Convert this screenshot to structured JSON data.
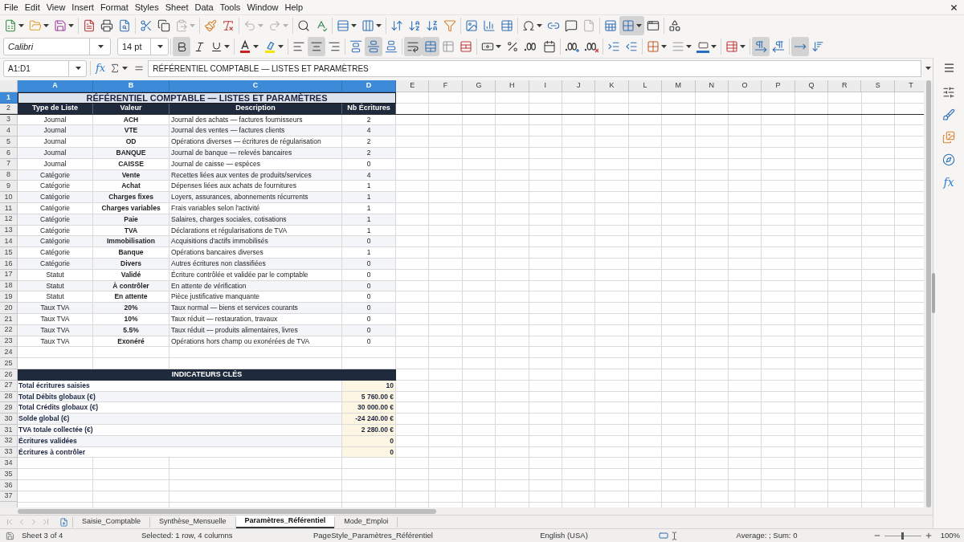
{
  "menu_bar": {
    "items": [
      "File",
      "Edit",
      "View",
      "Insert",
      "Format",
      "Styles",
      "Sheet",
      "Data",
      "Tools",
      "Window",
      "Help"
    ]
  },
  "standard_toolbar": {
    "paste_enabled": false,
    "undo_enabled": false,
    "redo_enabled": false,
    "headers_footers_enabled": false,
    "freeze_panes_active": true
  },
  "formatting_toolbar": {
    "font_name": "Calibri",
    "font_size": "14 pt",
    "bold": true,
    "italic": false,
    "underline": false,
    "align_left": false,
    "align_center": true,
    "align_right": false,
    "align_top": false,
    "align_middle": true,
    "align_bottom": false,
    "wrap_text": true,
    "merge_and_center": true,
    "left_to_right": true,
    "right_to_left": false,
    "text_horizontal": true,
    "text_vertical": false
  },
  "formula_bar": {
    "name_box": "A1:D1",
    "function_wizard": "fx",
    "content": "RÉFÉRENTIEL COMPTABLE — LISTES ET PARAMÈTRES"
  },
  "sidebar": {
    "functions_label": "fx"
  },
  "sheet": {
    "column_headers": [
      {
        "label": "A",
        "selected": true
      },
      {
        "label": "B",
        "selected": true
      },
      {
        "label": "C",
        "selected": true
      },
      {
        "label": "D",
        "selected": true
      },
      {
        "label": "E",
        "selected": false
      },
      {
        "label": "F",
        "selected": false
      },
      {
        "label": "G",
        "selected": false
      },
      {
        "label": "H",
        "selected": false
      },
      {
        "label": "I",
        "selected": false
      },
      {
        "label": "J",
        "selected": false
      },
      {
        "label": "K",
        "selected": false
      },
      {
        "label": "L",
        "selected": false
      },
      {
        "label": "M",
        "selected": false
      },
      {
        "label": "N",
        "selected": false
      },
      {
        "label": "O",
        "selected": false
      },
      {
        "label": "P",
        "selected": false
      },
      {
        "label": "Q",
        "selected": false
      },
      {
        "label": "R",
        "selected": false
      },
      {
        "label": "S",
        "selected": false
      },
      {
        "label": "T",
        "selected": false
      }
    ],
    "row_headers": [
      {
        "label": "1",
        "selected": true
      },
      {
        "label": "2",
        "selected": false
      },
      {
        "label": "3",
        "selected": false
      },
      {
        "label": "4",
        "selected": false
      },
      {
        "label": "5",
        "selected": false
      },
      {
        "label": "6",
        "selected": false
      },
      {
        "label": "7",
        "selected": false
      },
      {
        "label": "8",
        "selected": false
      },
      {
        "label": "9",
        "selected": false
      },
      {
        "label": "10",
        "selected": false
      },
      {
        "label": "11",
        "selected": false
      },
      {
        "label": "12",
        "selected": false
      },
      {
        "label": "13",
        "selected": false
      },
      {
        "label": "14",
        "selected": false
      },
      {
        "label": "15",
        "selected": false
      },
      {
        "label": "16",
        "selected": false
      },
      {
        "label": "17",
        "selected": false
      },
      {
        "label": "18",
        "selected": false
      },
      {
        "label": "19",
        "selected": false
      },
      {
        "label": "20",
        "selected": false
      },
      {
        "label": "21",
        "selected": false
      },
      {
        "label": "22",
        "selected": false
      },
      {
        "label": "23",
        "selected": false
      },
      {
        "label": "24",
        "selected": false
      },
      {
        "label": "25",
        "selected": false
      },
      {
        "label": "26",
        "selected": false
      },
      {
        "label": "27",
        "selected": false
      },
      {
        "label": "28",
        "selected": false
      },
      {
        "label": "29",
        "selected": false
      },
      {
        "label": "30",
        "selected": false
      },
      {
        "label": "31",
        "selected": false
      },
      {
        "label": "32",
        "selected": false
      },
      {
        "label": "33",
        "selected": false
      },
      {
        "label": "34",
        "selected": false
      },
      {
        "label": "35",
        "selected": false
      },
      {
        "label": "36",
        "selected": false
      },
      {
        "label": "37",
        "selected": false
      }
    ],
    "title": "RÉFÉRENTIEL COMPTABLE — LISTES ET PARAMÈTRES",
    "header": [
      "Type de Liste",
      "Valeur",
      "Description",
      "Nb Écritures"
    ],
    "rows": [
      [
        "Journal",
        "ACH",
        "Journal des achats — factures fournisseurs",
        "2"
      ],
      [
        "Journal",
        "VTE",
        "Journal des ventes — factures clients",
        "4"
      ],
      [
        "Journal",
        "OD",
        "Opérations diverses — écritures de régularisation",
        "2"
      ],
      [
        "Journal",
        "BANQUE",
        "Journal de banque — relevés bancaires",
        "2"
      ],
      [
        "Journal",
        "CAISSE",
        "Journal de caisse — espèces",
        "0"
      ],
      [
        "Catégorie",
        "Vente",
        "Recettes liées aux ventes de produits/services",
        "4"
      ],
      [
        "Catégorie",
        "Achat",
        "Dépenses liées aux achats de fournitures",
        "1"
      ],
      [
        "Catégorie",
        "Charges fixes",
        "Loyers, assurances, abonnements récurrents",
        "1"
      ],
      [
        "Catégorie",
        "Charges variables",
        "Frais variables selon l'activité",
        "1"
      ],
      [
        "Catégorie",
        "Paie",
        "Salaires, charges sociales, cotisations",
        "1"
      ],
      [
        "Catégorie",
        "TVA",
        "Déclarations et régularisations de TVA",
        "1"
      ],
      [
        "Catégorie",
        "Immobilisation",
        "Acquisitions d'actifs immobilisés",
        "0"
      ],
      [
        "Catégorie",
        "Banque",
        "Opérations bancaires diverses",
        "1"
      ],
      [
        "Catégorie",
        "Divers",
        "Autres écritures non classifiées",
        "0"
      ],
      [
        "Statut",
        "Validé",
        "Écriture contrôlée et validée par le comptable",
        "0"
      ],
      [
        "Statut",
        "À contrôler",
        "En attente de vérification",
        "0"
      ],
      [
        "Statut",
        "En attente",
        "Pièce justificative manquante",
        "0"
      ],
      [
        "Taux TVA",
        "20%",
        "Taux normal — biens et services courants",
        "0"
      ],
      [
        "Taux TVA",
        "10%",
        "Taux réduit — restauration, travaux",
        "0"
      ],
      [
        "Taux TVA",
        "5.5%",
        "Taux réduit — produits alimentaires, livres",
        "0"
      ],
      [
        "Taux TVA",
        "Exonéré",
        "Opérations hors champ ou exonérées de TVA",
        "0"
      ]
    ],
    "section_title": "INDICATEURS CLÉS",
    "indicators": [
      {
        "label": "Total écritures saisies",
        "value": "10"
      },
      {
        "label": "Total Débits globaux (€)",
        "value": "5 760.00 €"
      },
      {
        "label": "Total Crédits globaux (€)",
        "value": "30 000.00 €"
      },
      {
        "label": "Solde global (€)",
        "value": "-24 240.00 €"
      },
      {
        "label": "TVA totale collectée (€)",
        "value": "2 280.00 €"
      },
      {
        "label": "Écritures validées",
        "value": "0"
      },
      {
        "label": "Écritures à contrôler",
        "value": "0"
      }
    ]
  },
  "sheet_tabs": {
    "navigation_enabled": false,
    "tabs": [
      {
        "label": "Saisie_Comptable",
        "selected": false
      },
      {
        "label": "Synthèse_Mensuelle",
        "selected": false
      },
      {
        "label": "Paramètres_Référentiel",
        "selected": true
      },
      {
        "label": "Mode_Emploi",
        "selected": false
      }
    ]
  },
  "status_bar": {
    "sheet_position": "Sheet 3 of 4",
    "selection": "Selected: 1 row, 4 columns",
    "page_style": "PageStyle_Paramètres_Référentiel",
    "language": "English (USA)",
    "summary": "Average: ; Sum: 0",
    "zoom_slider": {
      "level": 0.5
    },
    "zoom": "100%"
  }
}
